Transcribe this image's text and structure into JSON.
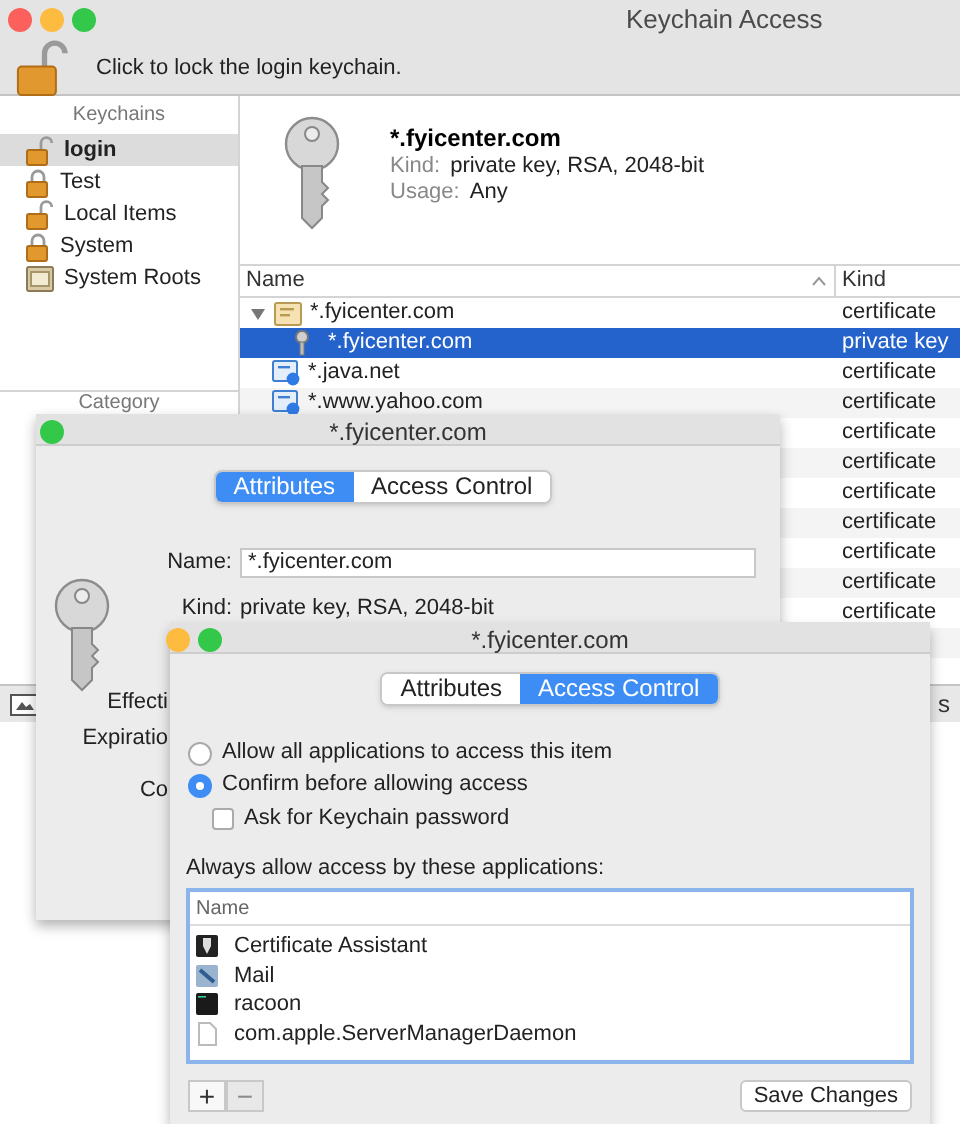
{
  "main_window": {
    "title": "Keychain Access",
    "lock_message": "Click to lock the login keychain.",
    "keychains_header": "Keychains",
    "keychains": [
      {
        "label": "login",
        "kind": "unlocked",
        "selected": true
      },
      {
        "label": "Test",
        "kind": "locked",
        "selected": false
      },
      {
        "label": "Local Items",
        "kind": "unlocked",
        "selected": false
      },
      {
        "label": "System",
        "kind": "locked",
        "selected": false
      },
      {
        "label": "System Roots",
        "kind": "roots",
        "selected": false
      }
    ],
    "category_header": "Category",
    "detail": {
      "name": "*.fyicenter.com",
      "kind_label": "Kind:",
      "kind": "private key, RSA, 2048-bit",
      "usage_label": "Usage:",
      "usage": "Any"
    },
    "table": {
      "columns": [
        "Name",
        "Kind"
      ],
      "rows": [
        {
          "kind": "group",
          "name": "*.fyicenter.com",
          "type": "certificate",
          "expanded": true,
          "selected": false
        },
        {
          "kind": "key",
          "name": "*.fyicenter.com",
          "type": "private key",
          "selected": true
        },
        {
          "kind": "certificate",
          "name": "*.java.net",
          "type": "certificate",
          "selected": false
        },
        {
          "kind": "certificate",
          "name": "*.www.yahoo.com",
          "type": "certificate",
          "selected": false
        },
        {
          "kind": "hidden",
          "type": "certificate",
          "selected": false
        },
        {
          "kind": "hidden",
          "type": "certificate",
          "selected": false
        },
        {
          "kind": "hidden",
          "type": "certificate",
          "selected": false
        },
        {
          "kind": "hidden",
          "type": "certificate",
          "selected": false
        },
        {
          "kind": "hidden",
          "type": "certificate",
          "selected": false
        },
        {
          "kind": "hidden",
          "type": "certificate",
          "selected": false
        },
        {
          "kind": "hidden",
          "type": "certificate",
          "selected": false
        }
      ]
    },
    "bottom_text": "s"
  },
  "attributes_window": {
    "title": "*.fyicenter.com",
    "tabs": [
      {
        "label": "Attributes",
        "selected": true
      },
      {
        "label": "Access Control",
        "selected": false
      }
    ],
    "name_label": "Name:",
    "name_value": "*.fyicenter.com",
    "kind_label": "Kind:",
    "kind_value": "private key, RSA, 2048-bit",
    "partial_labels": [
      "Effecti",
      "Expiratio",
      "Co"
    ]
  },
  "access_window": {
    "title": "*.fyicenter.com",
    "tabs": [
      {
        "label": "Attributes",
        "selected": false
      },
      {
        "label": "Access Control",
        "selected": true
      }
    ],
    "options": [
      {
        "kind": "radio",
        "label": "Allow all applications to access this item",
        "selected": false
      },
      {
        "kind": "radio",
        "label": "Confirm before allowing access",
        "selected": true
      },
      {
        "kind": "checkbox",
        "label": "Ask for Keychain password",
        "checked": false
      }
    ],
    "apps_label": "Always allow access by these applications:",
    "apps_column": "Name",
    "apps": [
      {
        "kind": "assistant",
        "name": "Certificate Assistant"
      },
      {
        "kind": "mail",
        "name": "Mail"
      },
      {
        "kind": "terminal",
        "name": "racoon"
      },
      {
        "kind": "document",
        "name": "com.apple.ServerManagerDaemon"
      }
    ],
    "list_buttons": [
      {
        "label": "+",
        "disabled": false
      },
      {
        "label": "−",
        "disabled": true
      }
    ],
    "save_button": "Save Changes"
  }
}
